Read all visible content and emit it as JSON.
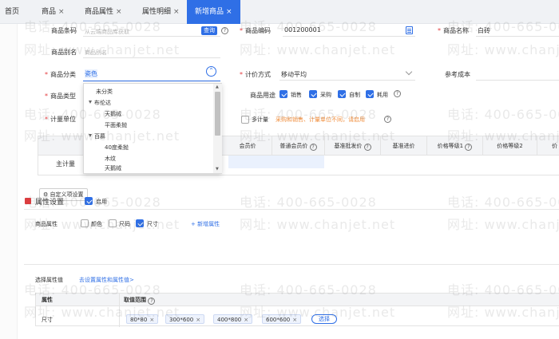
{
  "tabs": [
    {
      "label": "首页",
      "closable": false,
      "active": false
    },
    {
      "label": "商品",
      "closable": true,
      "active": false
    },
    {
      "label": "商品属性",
      "closable": true,
      "active": false
    },
    {
      "label": "属性明细",
      "closable": true,
      "active": false
    },
    {
      "label": "新增商品",
      "closable": true,
      "active": true
    }
  ],
  "close_glyph": "×",
  "watermark": {
    "phone": "电话: 400-665-0028",
    "site": "网址: www.chanjet.net"
  },
  "form": {
    "barcode_label": "商品条码",
    "barcode_placeholder": "从云端商品库获取",
    "query_button": "查询",
    "code_label": "商品编码",
    "code_value": "001200001",
    "name_label": "商品名称",
    "name_value": "白砖",
    "alias_label": "商品别名",
    "alias_placeholder": "商品别名",
    "category_label": "商品分类",
    "category_value": "瓷色",
    "pricing_label": "计价方式",
    "pricing_value": "移动平均",
    "ref_cost_label": "参考成本",
    "type_label": "商品类型",
    "usage_label": "商品用途",
    "usages": [
      {
        "label": "销售",
        "checked": true
      },
      {
        "label": "采购",
        "checked": true
      },
      {
        "label": "自制",
        "checked": true
      },
      {
        "label": "耗用",
        "checked": true
      }
    ],
    "unit_label": "计量单位",
    "multi_unit_label": "多计量",
    "multi_unit_hint": "采购和销售、计量单位不同，请启用"
  },
  "category_dropdown": {
    "items": [
      {
        "label": "未分类",
        "level": 0,
        "expandable": false
      },
      {
        "label": "布伦达",
        "level": 0,
        "expandable": true
      },
      {
        "label": "天鹅绒",
        "level": 1,
        "expandable": false
      },
      {
        "label": "平面柔抛",
        "level": 1,
        "expandable": false
      },
      {
        "label": "百慕",
        "level": 0,
        "expandable": true
      },
      {
        "label": "40度柔抛",
        "level": 1,
        "expandable": false
      },
      {
        "label": "木纹",
        "level": 1,
        "expandable": false
      },
      {
        "label": "天鹅绒",
        "level": 1,
        "expandable": false
      }
    ]
  },
  "price_grid": {
    "columns": [
      "会员价",
      "普通会员价",
      "基准批发价",
      "基准进价",
      "价格等级1",
      "价格等级2",
      "价"
    ],
    "row_label": "主计量"
  },
  "custom_button": "自定义项设置",
  "attr_section": {
    "title": "属性设置",
    "enabled_label": "启用",
    "attr_label": "商品属性",
    "attrs": [
      {
        "label": "颜色",
        "checked": false
      },
      {
        "label": "尺码",
        "checked": false
      },
      {
        "label": "尺寸",
        "checked": true
      }
    ],
    "add_attr": "+ 新增属性",
    "select_values_label": "选择属性值",
    "goto_link": "去设置属性和属性值>",
    "table_headers": [
      "属性",
      "取值范围"
    ],
    "row_attr": "尺寸",
    "values": [
      "80*80",
      "300*600",
      "400*800",
      "600*600"
    ],
    "pick_button": "选择"
  },
  "icons": {
    "help": "question-circle-icon",
    "calendar": "barcode-generate-icon",
    "tree_toggle": "caret-down-icon"
  }
}
